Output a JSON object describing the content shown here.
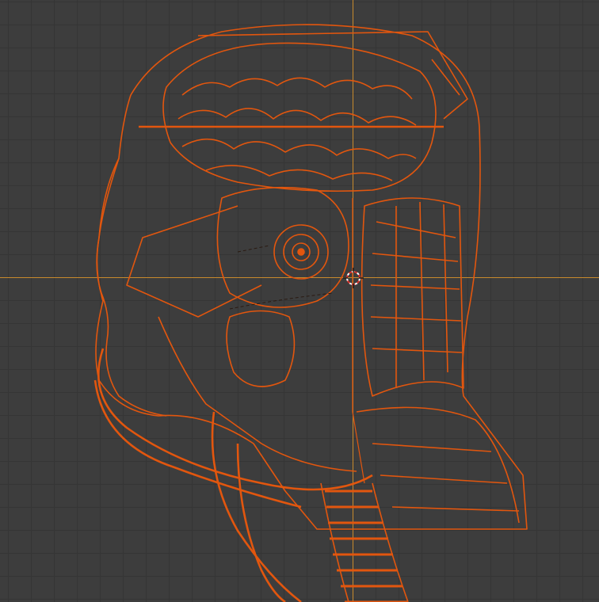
{
  "viewport": {
    "view": "side-orthographic",
    "shading": "wireframe",
    "grid": true,
    "object": "robot-head-wireframe",
    "selected": true,
    "colors": {
      "background": "#3d3d3d",
      "grid_line": "#353535",
      "axis_line": "#c88a2c",
      "selection": "#e2560e",
      "selection_dark": "#8a2c05",
      "cursor": "#ffffff"
    },
    "icons": [
      "3d-cursor-icon"
    ]
  }
}
